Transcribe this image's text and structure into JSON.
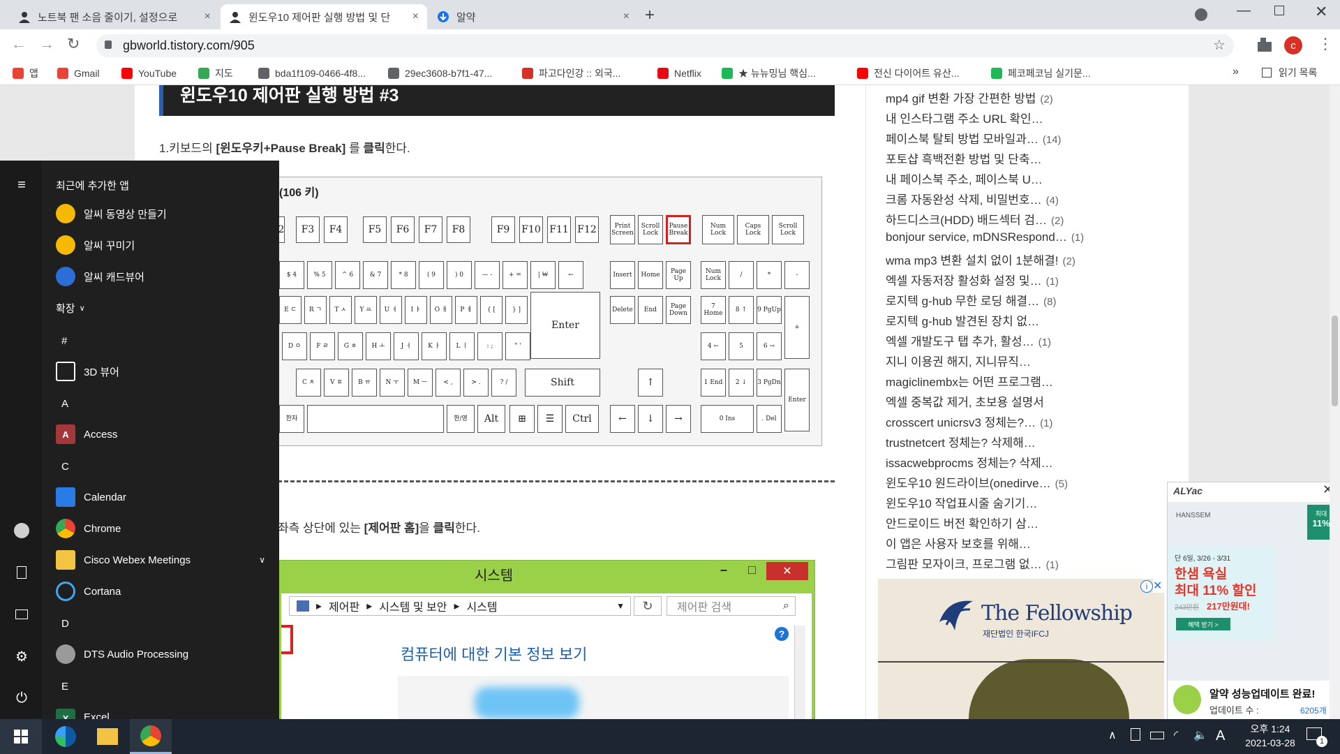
{
  "tabs": [
    {
      "title": "노트북 팬 소음 줄이기, 설정으로",
      "close": "×"
    },
    {
      "title": "윈도우10 제어판 실행 방법 및 단",
      "close": "×"
    },
    {
      "title": "알약",
      "close": "×"
    }
  ],
  "toolbar": {
    "url": "gbworld.tistory.com/905",
    "profile_initial": "c"
  },
  "bookmarks": [
    {
      "label": "앱",
      "icon": "apps-grid-icon",
      "color": "#ea4335"
    },
    {
      "label": "Gmail",
      "icon": "gmail-icon",
      "color": "#ea4335"
    },
    {
      "label": "YouTube",
      "icon": "youtube-icon",
      "color": "#ff0000"
    },
    {
      "label": "지도",
      "icon": "maps-icon",
      "color": "#34a853"
    },
    {
      "label": "bda1f109-0466-4f8...",
      "icon": "globe-icon",
      "color": "#5f6368"
    },
    {
      "label": "29ec3608-b7f1-47...",
      "icon": "globe-icon",
      "color": "#5f6368"
    },
    {
      "label": "파고다인강 :: 외국...",
      "icon": "pagoda-icon",
      "color": "#d93025"
    },
    {
      "label": "Netflix",
      "icon": "netflix-icon",
      "color": "#e50914"
    },
    {
      "label": "★ 뉴뉴밍님 핵심...",
      "icon": "bookmark-green-icon",
      "color": "#1db954"
    },
    {
      "label": "전신 다이어트 유산...",
      "icon": "youtube-icon",
      "color": "#ff0000"
    },
    {
      "label": "페코페코님 실기문...",
      "icon": "bookmark-green-icon",
      "color": "#1db954"
    }
  ],
  "bookmarks_more": "»",
  "reading_list": "읽기 목록",
  "article": {
    "heading": "윈도우10 제어판 실행 방법 #3",
    "step1_prefix": "1.키보드의 ",
    "step1_bold": "[윈도우키+Pause Break]",
    "step1_mid": " 를 ",
    "step1_bold2": "클릭",
    "step1_suffix": "한다.",
    "kbd_title": "(106 키)",
    "step2_prefix": "좌측 상단에 있는 ",
    "step2_bold": "[제어판 홈]",
    "step2_mid": "을 ",
    "step2_bold2": "클릭",
    "step2_suffix": "한다."
  },
  "keyboard": {
    "fkeys": [
      "2",
      "F3",
      "F4",
      "F5",
      "F6",
      "F7",
      "F8",
      "F9",
      "F10",
      "F11",
      "F12"
    ],
    "sys1": [
      "Print Screen",
      "Scroll Lock",
      "Pause Break"
    ],
    "locks": [
      "Num Lock",
      "Caps Lock",
      "Scroll Lock"
    ],
    "row2": [
      "$ 4",
      "% 5",
      "^ 6",
      "& 7",
      "* 8",
      "( 9",
      ") 0",
      "— -",
      "+ =",
      "| ₩",
      "←"
    ],
    "nav1": [
      "Insert",
      "Home",
      "Page Up"
    ],
    "nav2": [
      "Delete",
      "End",
      "Page Down"
    ],
    "num1": [
      "Num Lock",
      "/",
      "*",
      "-"
    ],
    "row3": [
      "E ㄷ",
      "R ㄱ",
      "T ㅅ",
      "Y ㅛ",
      "U ㅕ",
      "I ㅑ",
      "O ㅐ",
      "P ㅔ",
      "{ [",
      "} ]"
    ],
    "enter": "Enter",
    "num2": [
      "7 Home",
      "8 ↑",
      "9 PgUp",
      "+"
    ],
    "row4": [
      "D ㅇ",
      "F ㄹ",
      "G ㅎ",
      "H ㅗ",
      "J ㅓ",
      "K ㅏ",
      "L ㅣ",
      ": ;",
      "\" '"
    ],
    "num3": [
      "4 ←",
      "5",
      "6 →"
    ],
    "row5": [
      "C ㅊ",
      "V ㅍ",
      "B ㅠ",
      "N ㅜ",
      "M ㅡ",
      "< ,",
      "> .",
      "? /"
    ],
    "shift": "Shift",
    "up": "↑",
    "num4": [
      "1 End",
      "2 ↓",
      "3 PgDn",
      "Enter"
    ],
    "row6": [
      "한자",
      "",
      "한/영",
      "Alt",
      "⊞",
      "☰",
      "Ctrl"
    ],
    "arrows": [
      "←",
      "↓",
      "→"
    ],
    "num5": [
      "0 Ins",
      ". Del"
    ]
  },
  "system_window": {
    "title": "시스템",
    "breadcrumb": [
      "제어판",
      "시스템 및 보안",
      "시스템"
    ],
    "search_placeholder": "제어판 검색",
    "headline": "컴퓨터에 대한 기본 정보 보기",
    "minimize": "–",
    "maximize": "□",
    "close": "✕"
  },
  "sidebar_list": [
    {
      "title": "mp4 gif 변환 가장 간편한 방법",
      "count": "(2)"
    },
    {
      "title": "내 인스타그램 주소 URL 확인…",
      "count": ""
    },
    {
      "title": "페이스북 탈퇴 방법 모바일과…",
      "count": "(14)"
    },
    {
      "title": "포토샵 흑백전환 방법 및 단축…",
      "count": ""
    },
    {
      "title": "내 페이스북 주소, 페이스북 U…",
      "count": ""
    },
    {
      "title": "크롬 자동완성 삭제, 비밀번호…",
      "count": "(4)"
    },
    {
      "title": "하드디스크(HDD) 배드섹터 검…",
      "count": "(2)"
    },
    {
      "title": "bonjour service, mDNSRespond…",
      "count": "(1)"
    },
    {
      "title": "wma mp3 변환 설치 없이 1분해결!",
      "count": "(2)"
    },
    {
      "title": "엑셀 자동저장 활성화 설정 및…",
      "count": "(1)"
    },
    {
      "title": "로지텍 g-hub 무한 로딩 해결…",
      "count": "(8)"
    },
    {
      "title": "로지텍 g-hub 발견된 장치 없…",
      "count": ""
    },
    {
      "title": "엑셀 개발도구 탭 추가, 활성…",
      "count": "(1)"
    },
    {
      "title": "지니 이용권 해지, 지니뮤직…",
      "count": ""
    },
    {
      "title": "magiclinembx는 어떤 프로그램…",
      "count": ""
    },
    {
      "title": "엑셀 중복값 제거, 초보용 설명서",
      "count": ""
    },
    {
      "title": "crosscert unicrsv3 정체는?…",
      "count": "(1)"
    },
    {
      "title": "trustnetcert 정체는? 삭제해…",
      "count": ""
    },
    {
      "title": "issacwebprocms 정체는? 삭제…",
      "count": ""
    },
    {
      "title": "윈도우10 원드라이브(onedirve…",
      "count": "(5)"
    },
    {
      "title": "윈도우10 작업표시줄 숨기기…",
      "count": ""
    },
    {
      "title": "안드로이드 버전 확인하기 삼…",
      "count": ""
    },
    {
      "title": "이 앱은 사용자 보호를 위해…",
      "count": ""
    },
    {
      "title": "그림판 모자이크, 프로그램 없…",
      "count": "(1)"
    }
  ],
  "ad_fellowship": {
    "brand": "The Fellowship",
    "sub": "재단법인 한국IFCJ"
  },
  "ad_alyac": {
    "brand": "ALYac",
    "hanssem": "HANSSEM",
    "badge_top": "최대",
    "badge": "11%",
    "date": "단 6일, 3/26 - 3/31",
    "promo1": "한샘 욕실",
    "promo2": "최대 11% 할인",
    "price_old": "243만원",
    "price_new": "217만원대!",
    "cta": "혜택 받기 >",
    "update_title": "알약 성능업데이트 완료!",
    "update_label": "업데이트 수 :",
    "update_count": "6205개"
  },
  "start_menu": {
    "recent_header": "최근에 추가한 앱",
    "recent": [
      "알씨 동영상 만들기",
      "알씨 꾸미기",
      "알씨 캐드뷰어"
    ],
    "expand": "확장",
    "sections": [
      {
        "letter": "#",
        "apps": [
          "3D 뷰어"
        ]
      },
      {
        "letter": "A",
        "apps": [
          "Access"
        ]
      },
      {
        "letter": "C",
        "apps": [
          "Calendar",
          "Chrome",
          "Cisco Webex Meetings",
          "Cortana"
        ]
      },
      {
        "letter": "D",
        "apps": [
          "DTS Audio Processing"
        ]
      },
      {
        "letter": "E",
        "apps": [
          "Excel"
        ]
      }
    ]
  },
  "taskbar": {
    "time": "오후 1:24",
    "date": "2021-03-28",
    "ime": "A",
    "notif_count": "1"
  }
}
